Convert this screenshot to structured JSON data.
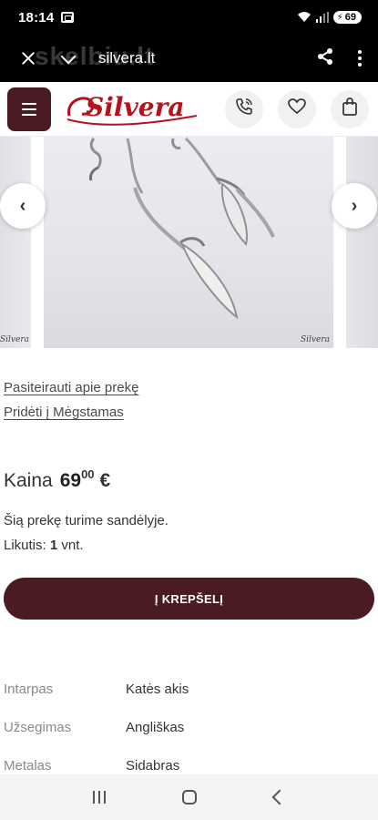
{
  "status_bar": {
    "time": "18:14",
    "battery": "69"
  },
  "browser": {
    "url": "silvera.lt",
    "watermark": "skelbiu.lt"
  },
  "site": {
    "logo_text": "Silvera"
  },
  "gallery": {
    "image_mark": "Silvera",
    "prev_symbol": "‹",
    "next_symbol": "›"
  },
  "product": {
    "inquire_link": "Pasiteirauti apie prekę",
    "favorite_link": "Pridėti į Mėgstamas",
    "price_label": "Kaina",
    "price_whole": "69",
    "price_cents": "00",
    "currency": "€",
    "stock_text": "Šią prekę turime sandėlyje.",
    "remaining_label": "Likutis:",
    "remaining_qty": "1",
    "remaining_unit": "vnt.",
    "cart_button": "Į KREPŠELĮ"
  },
  "attributes": [
    {
      "label": "Intarpas",
      "value": "Katės akis"
    },
    {
      "label": "Užsegimas",
      "value": "Angliškas"
    },
    {
      "label": "Metalas",
      "value": "Sidabras"
    }
  ],
  "colors": {
    "brand_dark": "#4a1b21",
    "logo_red": "#b5121b"
  }
}
